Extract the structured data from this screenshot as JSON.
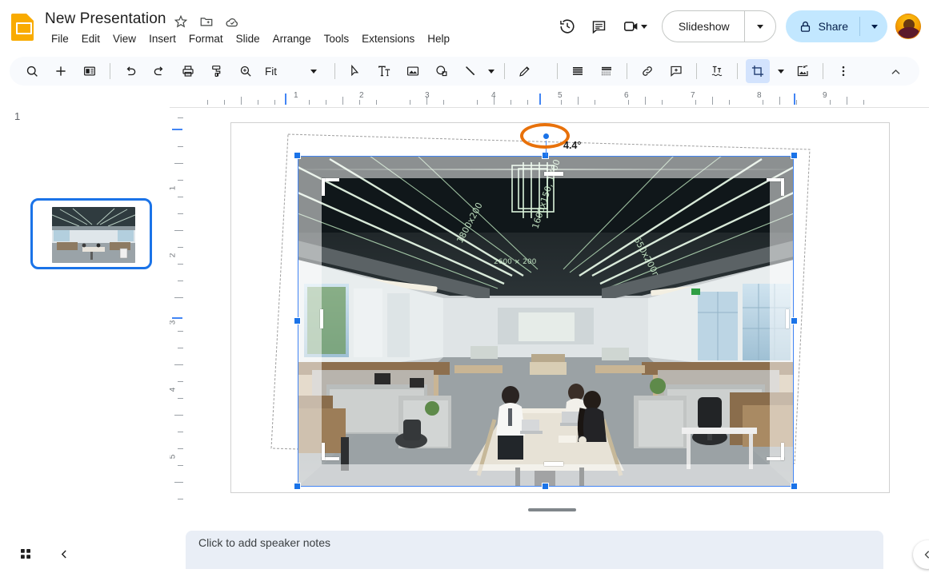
{
  "app": {
    "name": "Google Slides",
    "logo_icon": "slides-logo-icon"
  },
  "header": {
    "title": "New Presentation",
    "title_icons": [
      {
        "name": "star-icon",
        "label": "Star"
      },
      {
        "name": "move-to-folder-icon",
        "label": "Move"
      },
      {
        "name": "cloud-saved-icon",
        "label": "Saved to Drive"
      }
    ],
    "menus": [
      {
        "label": "File"
      },
      {
        "label": "Edit"
      },
      {
        "label": "View"
      },
      {
        "label": "Insert"
      },
      {
        "label": "Format"
      },
      {
        "label": "Slide"
      },
      {
        "label": "Arrange"
      },
      {
        "label": "Tools"
      },
      {
        "label": "Extensions"
      },
      {
        "label": "Help"
      }
    ],
    "right_icons": [
      {
        "name": "version-history-icon",
        "label": "Last edit"
      },
      {
        "name": "comment-history-icon",
        "label": "Open comment history"
      },
      {
        "name": "video-camera-icon",
        "label": "Join call"
      }
    ],
    "slideshow_label": "Slideshow",
    "share_label": "Share",
    "share_lock_icon": "lock-icon",
    "avatar_name": "account-avatar",
    "accent_blue": "#c2e7ff",
    "brand_yellow": "#F9AB00"
  },
  "toolbar": {
    "zoom_value": "Fit",
    "items": [
      {
        "name": "search-icon",
        "label": "Search"
      },
      {
        "name": "new-slide-icon",
        "label": "New slide"
      },
      {
        "name": "layout-icon",
        "label": "Layout"
      },
      {
        "name": "undo-icon",
        "label": "Undo"
      },
      {
        "name": "redo-icon",
        "label": "Redo"
      },
      {
        "name": "print-icon",
        "label": "Print"
      },
      {
        "name": "paint-format-icon",
        "label": "Paint format"
      },
      {
        "name": "zoom-icon",
        "label": "Zoom"
      },
      {
        "name": "select-cursor-icon",
        "label": "Select"
      },
      {
        "name": "text-box-icon",
        "label": "Text box"
      },
      {
        "name": "insert-image-icon",
        "label": "Image"
      },
      {
        "name": "shape-icon",
        "label": "Shape"
      },
      {
        "name": "line-icon",
        "label": "Line"
      },
      {
        "name": "pen-icon",
        "label": "Pen"
      },
      {
        "name": "align-icon",
        "label": "Align"
      },
      {
        "name": "line-spacing-icon",
        "label": "Line spacing"
      },
      {
        "name": "insert-link-icon",
        "label": "Insert link"
      },
      {
        "name": "add-comment-icon",
        "label": "Add comment"
      },
      {
        "name": "text-fitting-icon",
        "label": "Text fitting"
      },
      {
        "name": "crop-image-icon",
        "label": "Crop image"
      },
      {
        "name": "mask-image-icon",
        "label": "Mask image"
      },
      {
        "name": "more-options-icon",
        "label": "More"
      },
      {
        "name": "collapse-toolbar-icon",
        "label": "Hide the menus"
      }
    ],
    "active_tool": "crop-image-icon"
  },
  "filmstrip": {
    "slides": [
      {
        "number": "1",
        "selected": true,
        "thumb_alt": "Modern open-plan office interior"
      }
    ]
  },
  "rulers": {
    "horizontal_labels": [
      "1",
      "2",
      "3",
      "4",
      "5",
      "6",
      "7",
      "8",
      "9"
    ],
    "vertical_labels": [
      "1",
      "2",
      "3",
      "4",
      "5"
    ],
    "unit": "in"
  },
  "canvas": {
    "selected_object": "image-office-interior",
    "mode": "crop",
    "rotation_angle": "4.4°",
    "rotation_annotation_color": "#E8710A",
    "selection_color": "#4285f4",
    "image_alt": "Open-plan office with linear ceiling lights and people at a long table"
  },
  "notes": {
    "placeholder": "Click to add speaker notes"
  },
  "bottom_bar": {
    "grid_view_icon": "grid-view-icon",
    "collapse_filmstrip_icon": "chevron-left-icon",
    "explore_icon": "chevron-left-icon"
  }
}
